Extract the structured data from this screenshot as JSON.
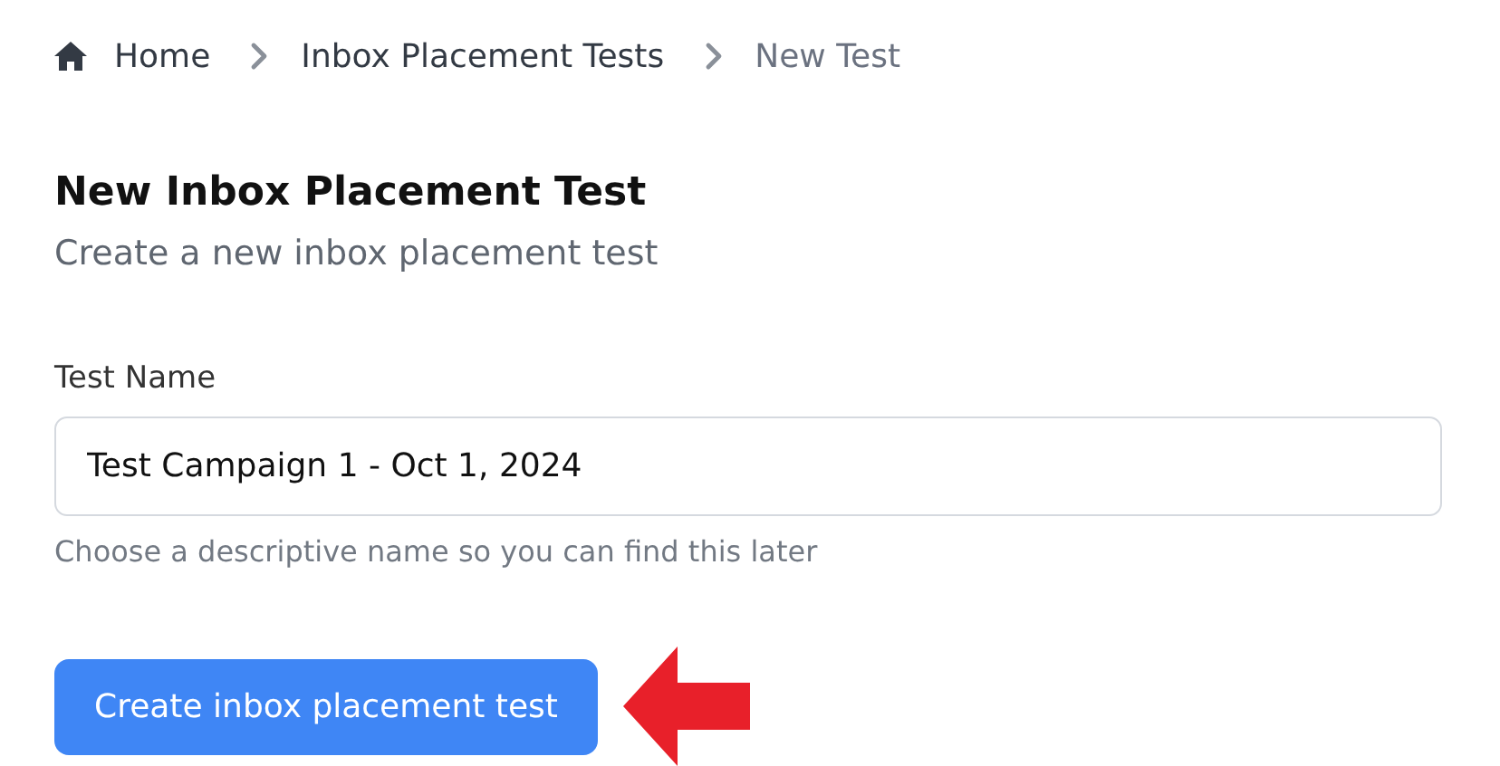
{
  "breadcrumb": [
    {
      "label": "Home",
      "kind": "home",
      "current": false
    },
    {
      "label": "Inbox Placement Tests",
      "kind": "link",
      "current": false
    },
    {
      "label": "New Test",
      "kind": "link",
      "current": true
    }
  ],
  "heading": "New Inbox Placement Test",
  "subheading": "Create a new inbox placement test",
  "form": {
    "label": "Test Name",
    "value": "Test Campaign 1 - Oct 1, 2024",
    "help": "Choose a descriptive name so you can find this later"
  },
  "submit_button": "Create inbox placement test"
}
